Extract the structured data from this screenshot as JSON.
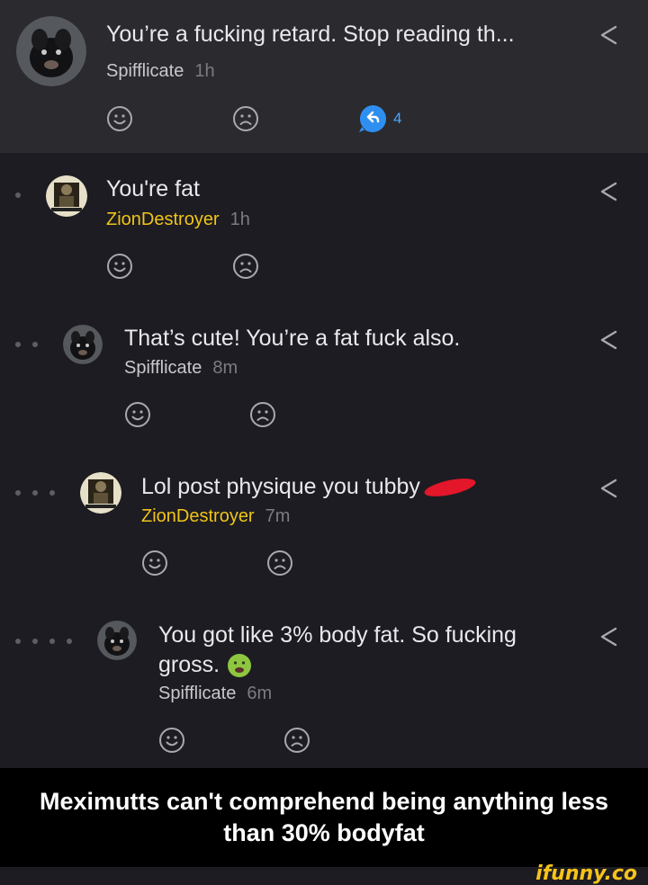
{
  "comments": [
    {
      "text": "You’re a fucking retard. Stop reading th...",
      "author": "Spifflicate",
      "time": "1h",
      "reply_count": "4",
      "avatar": "dog-avatar"
    },
    {
      "text": "You're fat",
      "author": "ZionDestroyer",
      "time": "1h",
      "avatar": "poster-avatar"
    },
    {
      "text": "That’s cute! You’re a fat fuck also.",
      "author": "Spifflicate",
      "time": "8m",
      "avatar": "dog-avatar"
    },
    {
      "text": "Lol post physique you tubby",
      "author": "ZionDestroyer",
      "time": "7m",
      "avatar": "poster-avatar"
    },
    {
      "text": "You got like 3% body fat. So fucking gross.",
      "author": "Spifflicate",
      "time": "6m",
      "avatar": "dog-avatar"
    }
  ],
  "caption": "Meximutts can't comprehend being anything less than 30% bodyfat",
  "watermark": "ifunny.co",
  "colors": {
    "background": "#1d1c22",
    "highlight_row": "#2a2a2f",
    "gold_author": "#f0c419",
    "reply_blue": "#4aa7ff",
    "censor_red": "#e3162a"
  }
}
